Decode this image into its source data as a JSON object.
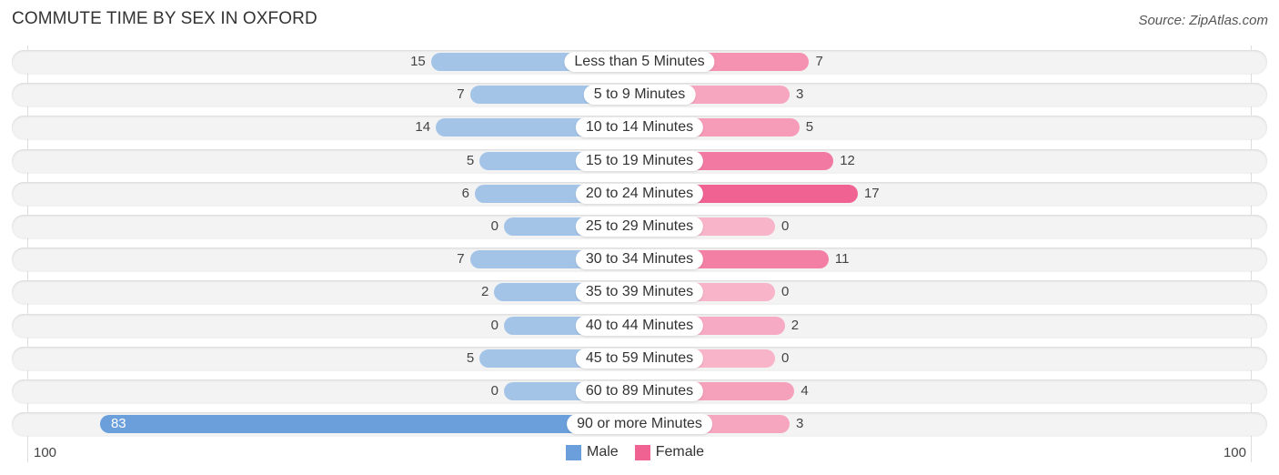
{
  "chart_data": {
    "type": "bar",
    "orientation": "horizontal-diverging",
    "title": "COMMUTE TIME BY SEX IN OXFORD",
    "source": "Source: ZipAtlas.com",
    "categories": [
      "Less than 5 Minutes",
      "5 to 9 Minutes",
      "10 to 14 Minutes",
      "15 to 19 Minutes",
      "20 to 24 Minutes",
      "25 to 29 Minutes",
      "30 to 34 Minutes",
      "35 to 39 Minutes",
      "40 to 44 Minutes",
      "45 to 59 Minutes",
      "60 to 89 Minutes",
      "90 or more Minutes"
    ],
    "series": [
      {
        "name": "Male",
        "color": "#6a9fdb",
        "values": [
          15,
          7,
          14,
          5,
          6,
          0,
          7,
          2,
          0,
          5,
          0,
          83
        ]
      },
      {
        "name": "Female",
        "color": "#f06292",
        "values": [
          7,
          3,
          5,
          12,
          17,
          0,
          11,
          0,
          2,
          0,
          4,
          3
        ]
      }
    ],
    "axis": {
      "left_max_label": "100",
      "right_max_label": "100",
      "range": [
        100,
        100
      ]
    },
    "legend": {
      "placement": "bottom-center",
      "items": [
        "Male",
        "Female"
      ]
    },
    "grid": false
  }
}
